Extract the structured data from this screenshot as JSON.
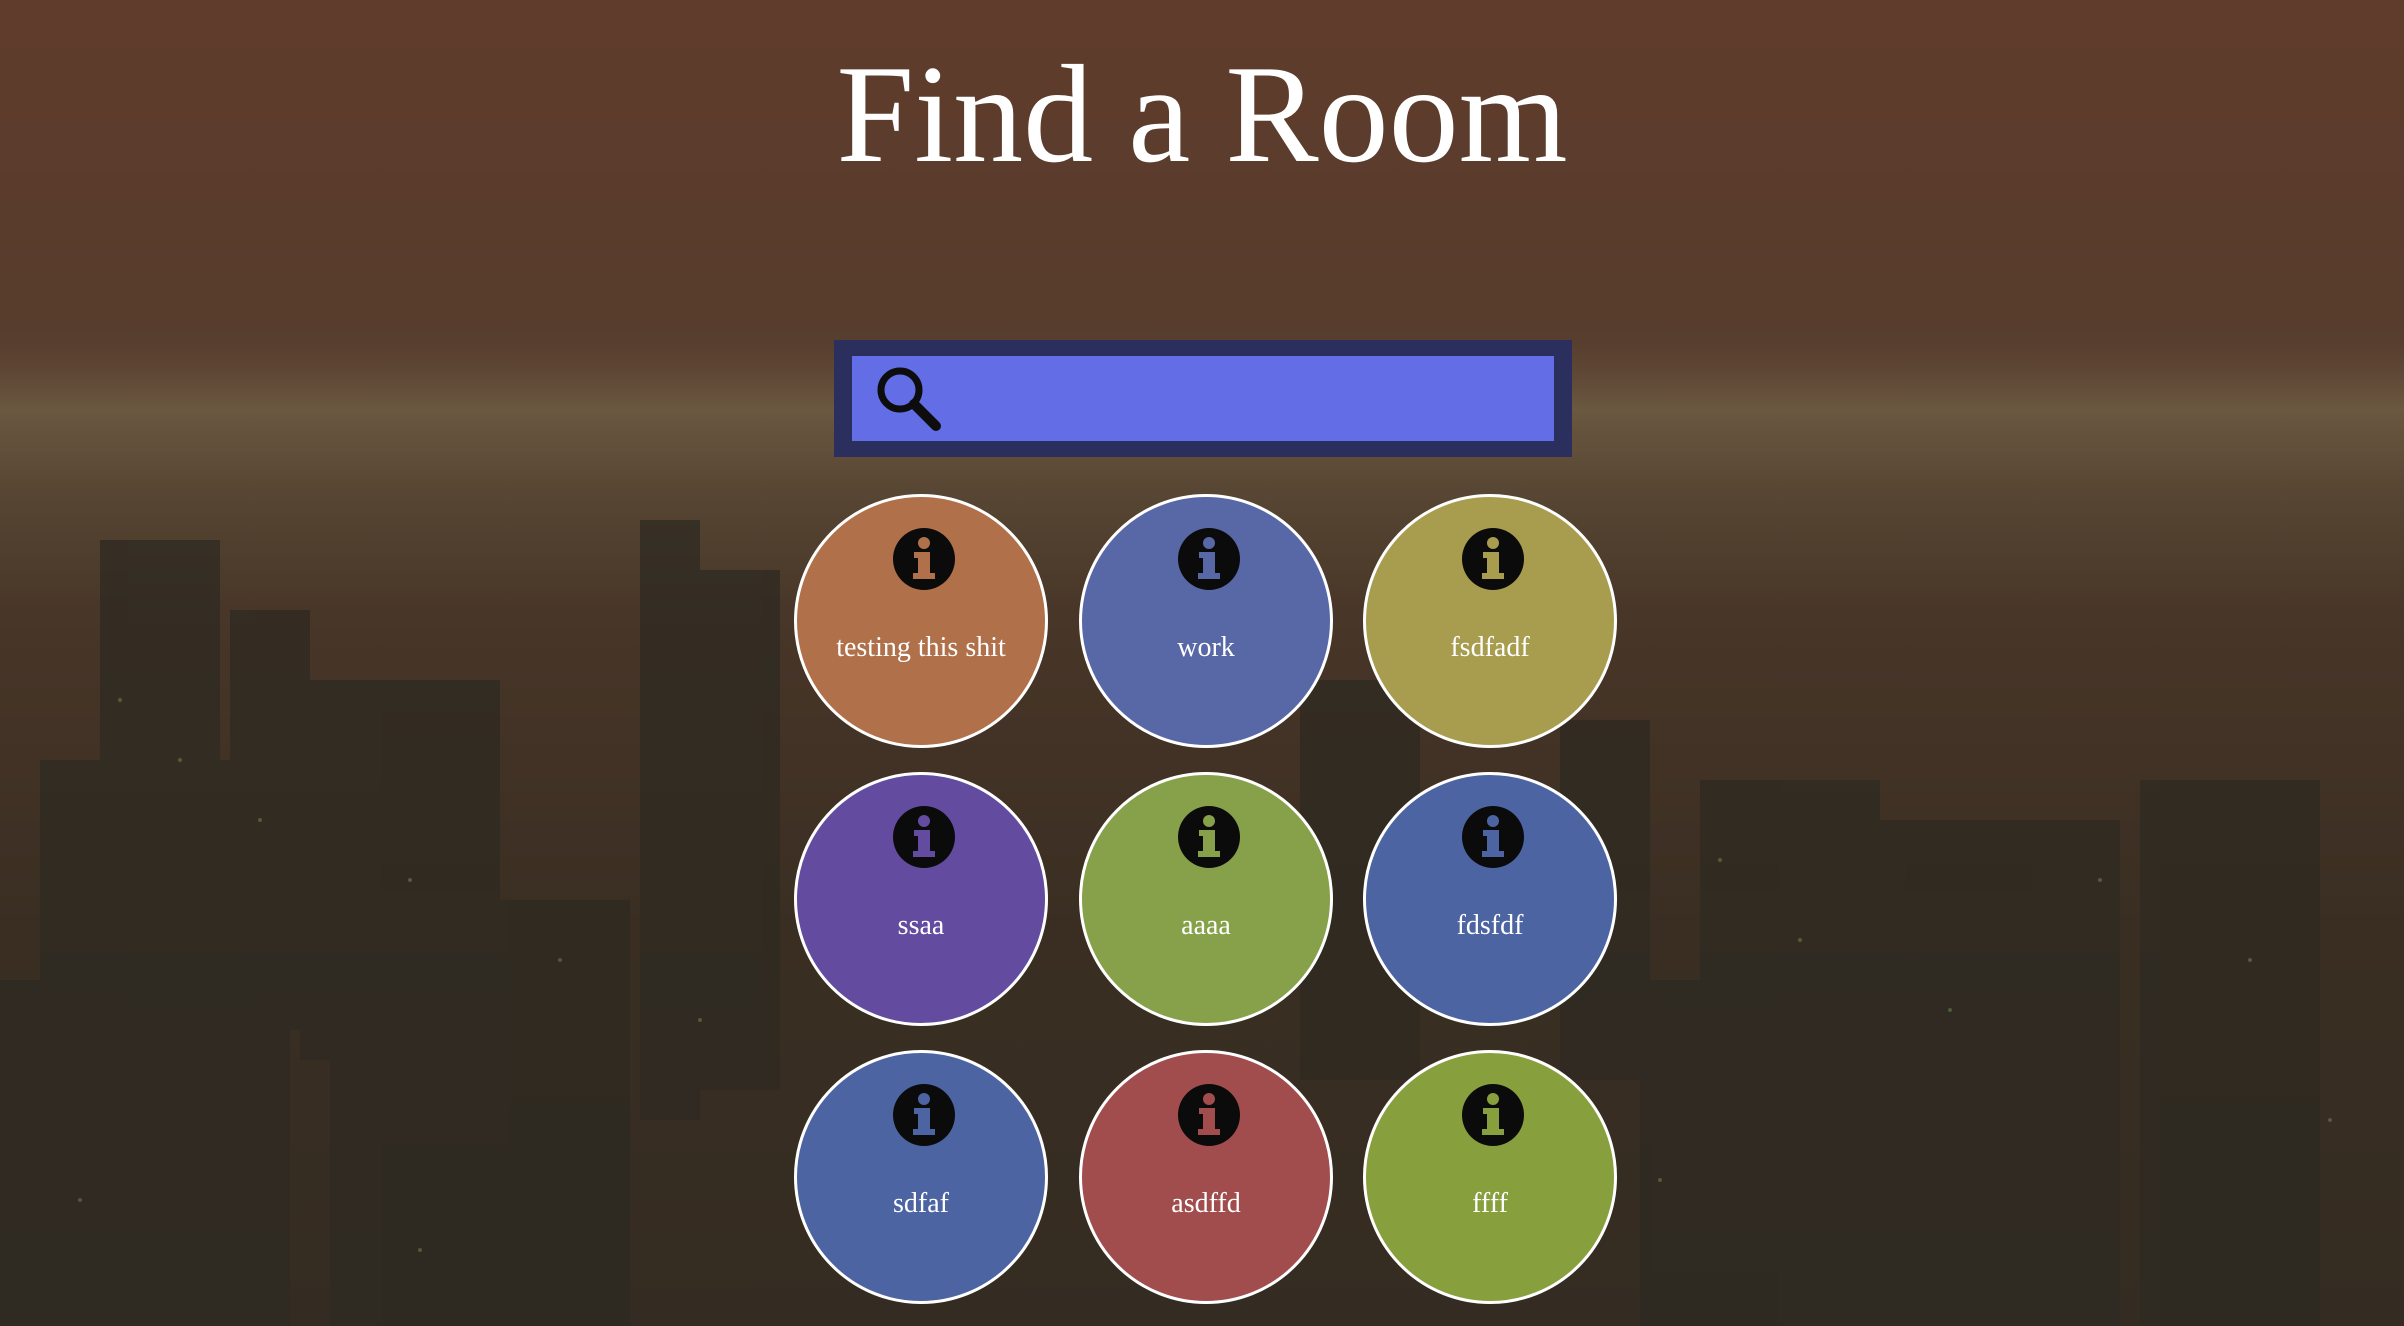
{
  "page": {
    "title": "Find a Room"
  },
  "search": {
    "placeholder": "",
    "value": "",
    "icon": "search-icon"
  },
  "colors": {
    "search_frame": "#2b2f5e",
    "search_field": "#636ee6",
    "room_border": "#ffffff"
  },
  "rooms": [
    {
      "label": "testing this shit",
      "color": "#b0704a",
      "icon": "info-icon"
    },
    {
      "label": "work",
      "color": "#5868a6",
      "icon": "info-icon"
    },
    {
      "label": "fsdfadf",
      "color": "#a89c4e",
      "icon": "info-icon"
    },
    {
      "label": "ssaa",
      "color": "#634ba0",
      "icon": "info-icon"
    },
    {
      "label": "aaaa",
      "color": "#87a04a",
      "icon": "info-icon"
    },
    {
      "label": "fdsfdf",
      "color": "#4d64a3",
      "icon": "info-icon"
    },
    {
      "label": "sdfaf",
      "color": "#4d64a3",
      "icon": "info-icon"
    },
    {
      "label": "asdffd",
      "color": "#a24d4d",
      "icon": "info-icon"
    },
    {
      "label": "ffff",
      "color": "#87a03d",
      "icon": "info-icon"
    }
  ]
}
